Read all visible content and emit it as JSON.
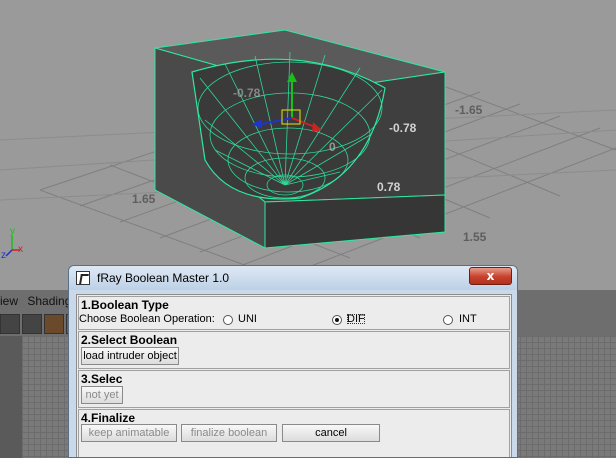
{
  "viewport": {
    "grid_labels": [
      "-1.65",
      "1.65",
      "-0.78",
      "0.78",
      "1.55",
      "0",
      "-0.78"
    ],
    "axis": {
      "x": "x",
      "y": "y",
      "z": "z"
    },
    "colors": {
      "grid_line": "#7f7f7f",
      "wireframe": "#2ee8a0",
      "object": "#444444",
      "background": "#9a9a9a"
    }
  },
  "maya": {
    "menu": [
      "iew",
      "Shading"
    ]
  },
  "dialog": {
    "title": "fRay Boolean Master 1.0",
    "close_label": "x",
    "sections": {
      "boolean_type": {
        "title": "1.Boolean Type",
        "label": "Choose Boolean Operation:",
        "options": [
          "UNI",
          "DIF",
          "INT"
        ],
        "selected": "DIF"
      },
      "select_boolean": {
        "title": "2.Select Boolean",
        "button": "load intruder object"
      },
      "select": {
        "title": "3.Selec",
        "button": "not yet"
      },
      "finalize": {
        "title": "4.Finalize",
        "buttons": [
          "keep animatable",
          "finalize boolean",
          "cancel"
        ]
      }
    }
  }
}
